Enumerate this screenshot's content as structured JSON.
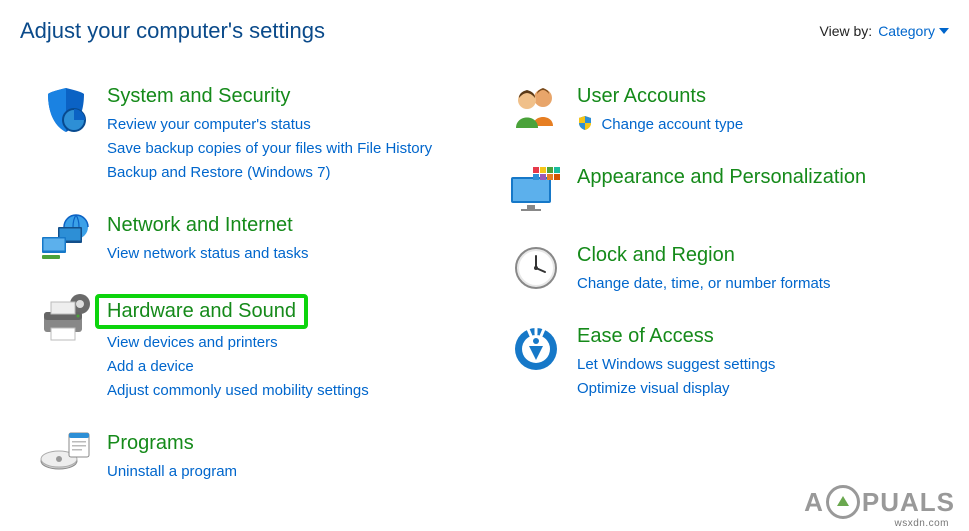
{
  "header": {
    "title": "Adjust your computer's settings",
    "viewby_label": "View by:",
    "viewby_value": "Category"
  },
  "left": [
    {
      "title": "System and Security",
      "links": [
        "Review your computer's status",
        "Save backup copies of your files with File History",
        "Backup and Restore (Windows 7)"
      ]
    },
    {
      "title": "Network and Internet",
      "links": [
        "View network status and tasks"
      ]
    },
    {
      "title": "Hardware and Sound",
      "links": [
        "View devices and printers",
        "Add a device",
        "Adjust commonly used mobility settings"
      ],
      "highlight": true
    },
    {
      "title": "Programs",
      "links": [
        "Uninstall a program"
      ]
    }
  ],
  "right": [
    {
      "title": "User Accounts",
      "links": [
        "Change account type"
      ],
      "shield": true
    },
    {
      "title": "Appearance and Personalization",
      "links": []
    },
    {
      "title": "Clock and Region",
      "links": [
        "Change date, time, or number formats"
      ]
    },
    {
      "title": "Ease of Access",
      "links": [
        "Let Windows suggest settings",
        "Optimize visual display"
      ]
    }
  ],
  "watermark": {
    "pre": "A",
    "post": "PUALS"
  },
  "source": "wsxdn.com"
}
